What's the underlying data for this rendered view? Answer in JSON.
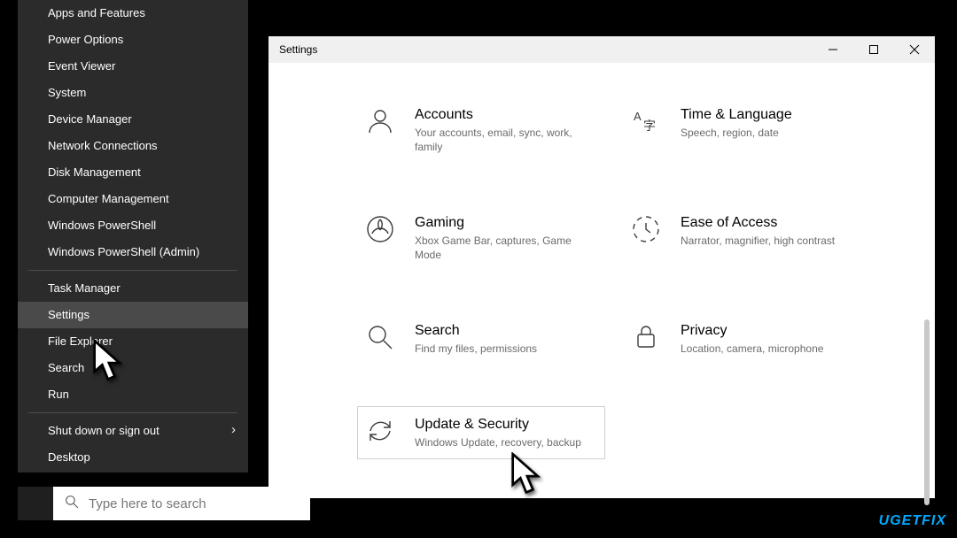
{
  "winx": {
    "groups": [
      [
        "Apps and Features",
        "Power Options",
        "Event Viewer",
        "System",
        "Device Manager",
        "Network Connections",
        "Disk Management",
        "Computer Management",
        "Windows PowerShell",
        "Windows PowerShell (Admin)"
      ],
      [
        "Task Manager",
        "Settings",
        "File Explorer",
        "Search",
        "Run"
      ],
      [
        "Shut down or sign out",
        "Desktop"
      ]
    ],
    "hovered": "Settings",
    "submenu": [
      "Shut down or sign out"
    ]
  },
  "settings_window": {
    "title": "Settings",
    "tiles": [
      {
        "id": "accounts",
        "title": "Accounts",
        "desc": "Your accounts, email, sync, work, family"
      },
      {
        "id": "time",
        "title": "Time & Language",
        "desc": "Speech, region, date"
      },
      {
        "id": "gaming",
        "title": "Gaming",
        "desc": "Xbox Game Bar, captures, Game Mode"
      },
      {
        "id": "ease",
        "title": "Ease of Access",
        "desc": "Narrator, magnifier, high contrast"
      },
      {
        "id": "search",
        "title": "Search",
        "desc": "Find my files, permissions"
      },
      {
        "id": "privacy",
        "title": "Privacy",
        "desc": "Location, camera, microphone"
      },
      {
        "id": "update",
        "title": "Update & Security",
        "desc": "Windows Update, recovery, backup"
      }
    ],
    "selected": "update"
  },
  "taskbar": {
    "search_placeholder": "Type here to search"
  },
  "watermark": "UGETFIX"
}
